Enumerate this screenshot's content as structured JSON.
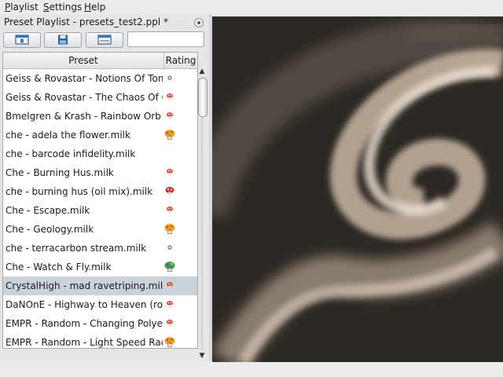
{
  "menubar": {
    "items": [
      "Playlist",
      "Settings",
      "Help"
    ]
  },
  "panel": {
    "title": "Preset Playlist - presets_test2.ppl *"
  },
  "toolbar": {
    "buttons": [
      "new-playlist-icon",
      "save-icon",
      "window-icon"
    ],
    "search_value": ""
  },
  "list": {
    "headers": {
      "preset": "Preset",
      "rating": "Rating"
    },
    "rows": [
      {
        "name": "Geiss & Rovastar - Notions Of Tonal...",
        "rating": "tiny"
      },
      {
        "name": "Geiss & Rovastar - The Chaos Of C...",
        "rating": "small"
      },
      {
        "name": "Bmelgren & Krash - Rainbow Orb Pe...",
        "rating": "small"
      },
      {
        "name": "che - adela the flower.milk",
        "rating": "big-orange"
      },
      {
        "name": "che - barcode infidelity.milk",
        "rating": "none"
      },
      {
        "name": "Che - Burning Hus.milk",
        "rating": "small"
      },
      {
        "name": "che - burning hus (oil mix).milk",
        "rating": "red"
      },
      {
        "name": "Che - Escape.milk",
        "rating": "small"
      },
      {
        "name": "Che - Geology.milk",
        "rating": "big-orange"
      },
      {
        "name": "che - terracarbon stream.milk",
        "rating": "tiny"
      },
      {
        "name": "Che - Watch & Fly.milk",
        "rating": "blue-green"
      },
      {
        "name": "CrystalHigh - mad ravetriping.milk",
        "rating": "small",
        "selected": true
      },
      {
        "name": "DaNOnE - Highway to Heaven (rotat...",
        "rating": "small"
      },
      {
        "name": "EMPR - Random - Changing Polyev...",
        "rating": "small"
      },
      {
        "name": "EMPR - Random - Light Speed Race...",
        "rating": "big-orange"
      }
    ]
  },
  "status_icons": [
    "cube-icon",
    "lock-icon"
  ],
  "colors": {
    "selection": "#c9d1da",
    "visualizer_bg": "#2c2823",
    "smoke": "#d9c4b0"
  }
}
